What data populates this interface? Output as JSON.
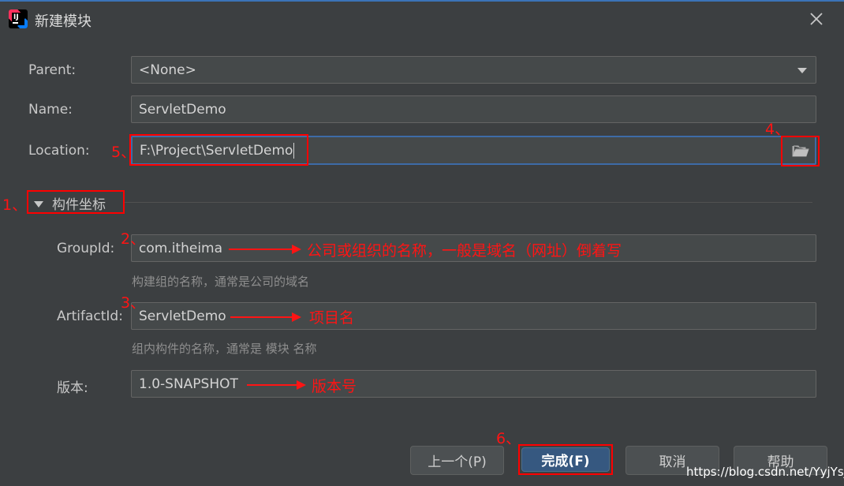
{
  "window": {
    "title": "新建模块"
  },
  "form": {
    "parent_label": "Parent:",
    "parent_value": "<None>",
    "name_label": "Name:",
    "name_value": "ServletDemo",
    "location_label": "Location:",
    "location_value": "F:\\Project\\ServletDemo"
  },
  "section": {
    "title": "构件坐标"
  },
  "coords": {
    "groupid_label": "GroupId:",
    "groupid_value": "com.itheima",
    "groupid_hint": "构建组的名称，通常是公司的域名",
    "artifactid_label": "ArtifactId:",
    "artifactid_value": "ServletDemo",
    "artifactid_hint": "组内构件的名称，通常是 模块 名称",
    "version_label": "版本:",
    "version_value": "1.0-SNAPSHOT"
  },
  "buttons": {
    "previous": "上一个(P)",
    "finish": "完成(F)",
    "cancel": "取消",
    "help": "帮助"
  },
  "annotations": {
    "n1": "1、",
    "n2": "2、",
    "n3": "3、",
    "n4": "4、",
    "n5": "5、",
    "n6": "6、",
    "groupid_note": "公司或组织的名称，一般是域名（网址）倒着写",
    "artifactid_note": "项目名",
    "version_note": "版本号"
  },
  "watermark": "https://blog.csdn.net/YyjYsj",
  "colors": {
    "accent": "#3d6ba7",
    "annotation": "#ff1414",
    "primary_button": "#365880"
  }
}
